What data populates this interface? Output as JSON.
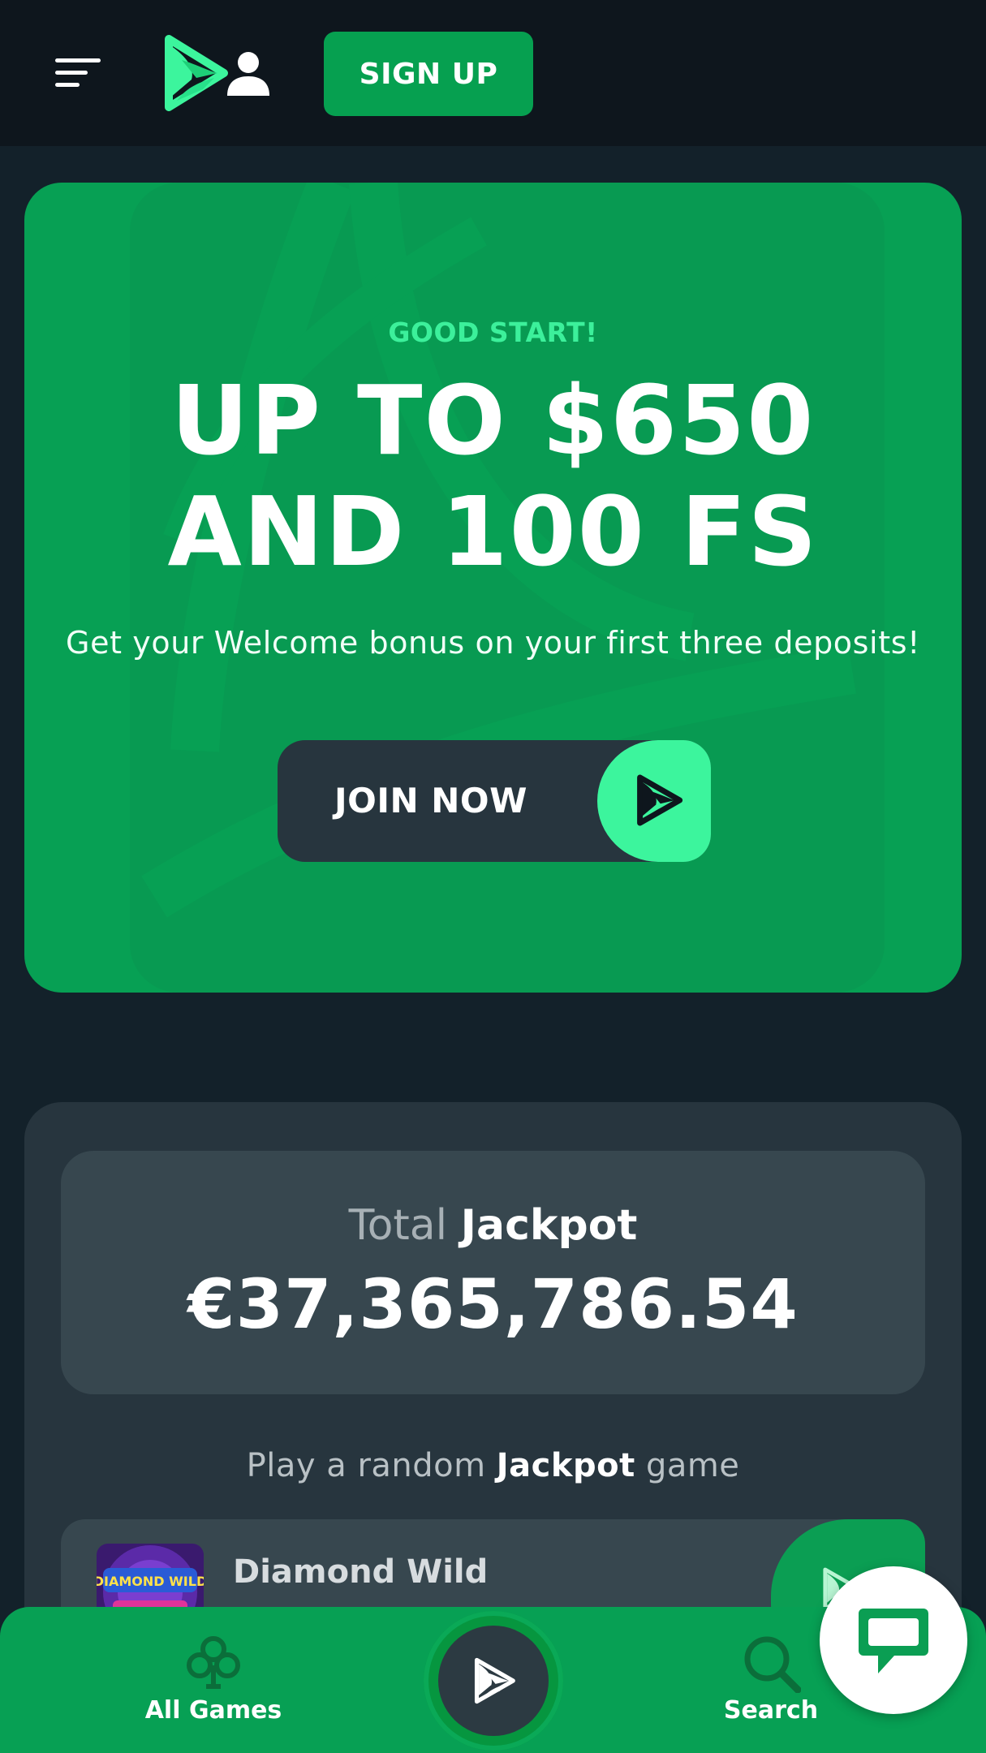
{
  "header": {
    "menu_icon": "hamburger-menu-icon",
    "logo_icon": "brand-logo-icon",
    "account_icon": "user-icon",
    "signup_label": "SIGN UP"
  },
  "hero": {
    "eyebrow": "GOOD START!",
    "headline_line1": "UP TO $650",
    "headline_line2": "AND 100 FS",
    "subtext": "Get your Welcome bonus on your first three deposits!",
    "cta_label": "JOIN NOW",
    "cta_icon": "brand-logo-icon"
  },
  "jackpot": {
    "title_light": "Total",
    "title_bold": "Jackpot",
    "amount": "€37,365,786.54",
    "random_prefix": "Play a random",
    "random_bold": "Jackpot",
    "random_suffix": "game",
    "games": [
      {
        "name": "Diamond Wild",
        "thumb_text": "DIAMOND WILD"
      }
    ]
  },
  "bottom_nav": {
    "items": [
      {
        "label": "All Games",
        "icon": "club-icon"
      },
      {
        "label": "",
        "icon": "brand-logo-icon"
      },
      {
        "label": "Search",
        "icon": "search-icon"
      }
    ]
  },
  "chat": {
    "icon": "chat-bubble-icon"
  },
  "colors": {
    "header_bg": "#0e161d",
    "page_bg": "#13212a",
    "brand_green": "#07a054",
    "accent_mint": "#3cf59d",
    "panel_dark": "#27353e",
    "card": "#37474f"
  }
}
